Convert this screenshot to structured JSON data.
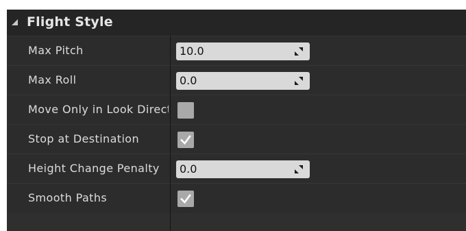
{
  "section": {
    "title": "Flight Style",
    "collapse_icon": "expanded-triangle-icon"
  },
  "properties": [
    {
      "label": "Max Pitch",
      "type": "number",
      "value": "10.0"
    },
    {
      "label": "Max Roll",
      "type": "number",
      "value": "0.0"
    },
    {
      "label": "Move Only in Look Direction",
      "type": "checkbox",
      "checked": false
    },
    {
      "label": "Stop at Destination",
      "type": "checkbox",
      "checked": true
    },
    {
      "label": "Height Change Penalty",
      "type": "number",
      "value": "0.0"
    },
    {
      "label": "Smooth Paths",
      "type": "checkbox",
      "checked": true
    }
  ],
  "colors": {
    "panel_bg": "#2f2f2f",
    "header_bg": "#252525",
    "input_bg": "#d9d9d9",
    "checkbox_bg": "#a9a9a9",
    "label_text": "#dcdcdc"
  }
}
